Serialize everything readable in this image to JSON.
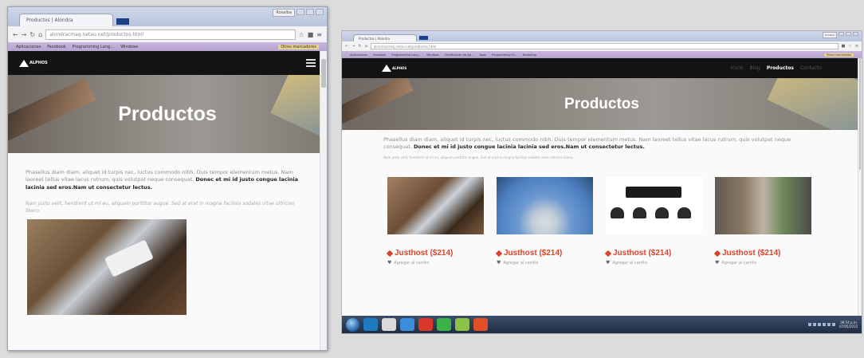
{
  "left_window": {
    "tab_title": "Productos | Alondra",
    "user_label": "Rosalba",
    "url": "alondracmaq.netau.net/productos.html",
    "bookmarks": [
      "Aplicaciones",
      "Facebook",
      "Programming Lang…",
      "Windows"
    ],
    "bookmarks_right": "Otros marcadores",
    "logo_text": "ALPHOS",
    "hero_title": "Productos",
    "lead_text": "Phasellus diam diam, aliquet id turpis nec, luctus commodo nibh. Duis tempor elementum metus. Nam laoreet tellus vitae lacus rutrum, quis volutpat neque consequat.",
    "lead_bold": "Donec et mi id justo congue lacinia lacinia sed eros.Nam ut consectetur lectus.",
    "small_text": "Nam justo velit, hendrerit ut mi eu, aliquam porttitor augue. Sed at erat in magna facilisis sodales vitae ultricies libero."
  },
  "right_window": {
    "tab_title": "Productos | Alondra",
    "user_label": "Rosalba",
    "url": "alondracmaq.netau.net/productos.html",
    "bookmarks": [
      "Aplicaciones",
      "Facebook",
      "Programming Lang…",
      "Windows",
      "Certificación de Ap…",
      "Apps",
      "Programming Tu…",
      "Bootstrap"
    ],
    "bookmarks_right": "Otros marcadores",
    "logo_text": "ALPHOS",
    "menu": [
      "Inicio",
      "Blog",
      "Productos",
      "Contacto"
    ],
    "hero_title": "Productos",
    "lead_text": "Phasellus diam diam, aliquet id turpis nec, luctus commodo nibh. Duis tempor elementum metus. Nam laoreet tellus vitae lacus rutrum, quis volutpat neque consequat.",
    "lead_bold": "Donec et mi id justo congue lacinia lacinia sed eros.Nam ut consectetur lectus.",
    "small_text": "Nam justo velit, hendrerit ut mi eu, aliquam porttitor augue. Sed at erat in magna facilisis sodales vitae ultricies libero.",
    "products": [
      {
        "name": "Justhost ($214)",
        "cart": "Agregar al carrito"
      },
      {
        "name": "Justhost ($214)",
        "cart": "Agregar al carrito"
      },
      {
        "name": "Justhost ($214)",
        "cart": "Agregar al carrito"
      },
      {
        "name": "Justhost ($214)",
        "cart": "Agregar al carrito"
      }
    ]
  },
  "taskbar": {
    "time": "09:54 p.m.",
    "date": "07/05/2015",
    "icon_colors": [
      "#1f7bbf",
      "#d9d9d9",
      "#3c8dd9",
      "#d9382b",
      "#3bb34a",
      "#8bc34a",
      "#e34f26"
    ]
  }
}
